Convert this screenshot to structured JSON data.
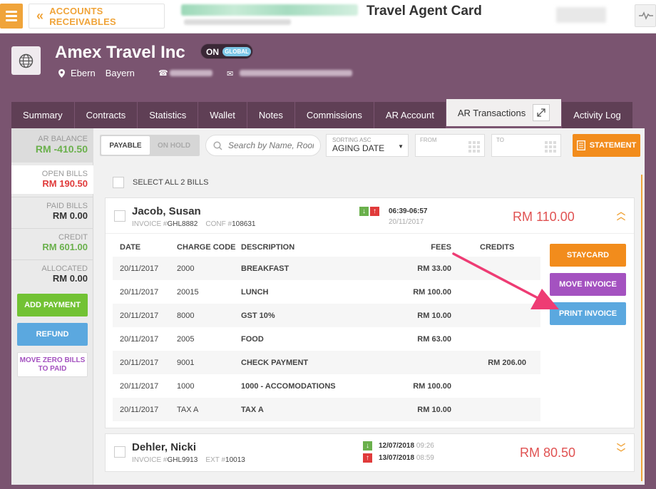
{
  "topbar": {
    "back_label": "ACCOUNTS RECEIVABLES",
    "page_title": "Travel Agent Card",
    "icons": [
      "menu-icon",
      "chevron-left-icon",
      "activity-pulse-icon"
    ]
  },
  "agent": {
    "name": "Amex Travel Inc",
    "toggle_on": "ON",
    "toggle_scope": "GLOBAL",
    "city": "Ebern",
    "region": "Bayern",
    "icons": [
      "globe-icon",
      "location-pin-icon",
      "phone-icon",
      "mail-icon"
    ]
  },
  "tabs": [
    "Summary",
    "Contracts",
    "Statistics",
    "Wallet",
    "Notes",
    "Commissions",
    "AR Account",
    "AR Transactions",
    "Activity Log"
  ],
  "sidebar": {
    "ar_balance_label": "AR BALANCE",
    "ar_balance_value": "RM -410.50",
    "open_bills_label": "OPEN BILLS",
    "open_bills_value": "RM 190.50",
    "paid_bills_label": "PAID BILLS",
    "paid_bills_value": "RM 0.00",
    "credit_label": "CREDIT",
    "credit_value": "RM 601.00",
    "allocated_label": "ALLOCATED",
    "allocated_value": "RM 0.00",
    "add_payment": "ADD PAYMENT",
    "refund": "REFUND",
    "move_zero": "MOVE ZERO BILLS TO PAID"
  },
  "filters": {
    "payable": "PAYABLE",
    "on_hold": "ON HOLD",
    "search_placeholder": "Search by Name, Room",
    "sort_label": "SORTING ASC",
    "sort_value": "AGING DATE",
    "from_label": "FROM",
    "to_label": "TO",
    "statement": "STATEMENT",
    "select_all": "SELECT ALL 2 BILLS"
  },
  "bills": [
    {
      "name": "Jacob, Susan",
      "invoice_label": "INVOICE #",
      "invoice_no": "GHL8882",
      "ref_label": "CONF #",
      "ref_no": "108631",
      "time": "06:39-06:57",
      "date": "20/11/2017",
      "amount": "RM 110.00",
      "columns": [
        "DATE",
        "CHARGE CODE",
        "DESCRIPTION",
        "FEES",
        "CREDITS"
      ],
      "rows": [
        {
          "date": "20/11/2017",
          "code": "2000",
          "desc": "BREAKFAST",
          "fees": "RM 33.00",
          "credits": ""
        },
        {
          "date": "20/11/2017",
          "code": "20015",
          "desc": "LUNCH",
          "fees": "RM 100.00",
          "credits": ""
        },
        {
          "date": "20/11/2017",
          "code": "8000",
          "desc": "GST 10%",
          "fees": "RM 10.00",
          "credits": ""
        },
        {
          "date": "20/11/2017",
          "code": "2005",
          "desc": "FOOD",
          "fees": "RM 63.00",
          "credits": ""
        },
        {
          "date": "20/11/2017",
          "code": "9001",
          "desc": "CHECK PAYMENT",
          "fees": "",
          "credits": "RM 206.00"
        },
        {
          "date": "20/11/2017",
          "code": "1000",
          "desc": "1000 - ACCOMODATIONS",
          "fees": "RM 100.00",
          "credits": ""
        },
        {
          "date": "20/11/2017",
          "code": "TAX A",
          "desc": "TAX A",
          "fees": "RM 10.00",
          "credits": ""
        }
      ],
      "actions": [
        "STAYCARD",
        "MOVE INVOICE",
        "PRINT INVOICE"
      ]
    },
    {
      "name": "Dehler, Nicki",
      "invoice_label": "INVOICE #",
      "invoice_no": "GHL9913",
      "ref_label": "EXT #",
      "ref_no": "10013",
      "arrival_date": "12/07/2018",
      "arrival_time": "09:26",
      "departure_date": "13/07/2018",
      "departure_time": "08:59",
      "amount": "RM 80.50"
    }
  ],
  "colors": {
    "brand_purple": "#7a5470",
    "accent_orange": "#f0a43a",
    "amount_red": "#e05252",
    "credit_green": "#6ab04c",
    "annotation_arrow": "#ee3c74"
  }
}
